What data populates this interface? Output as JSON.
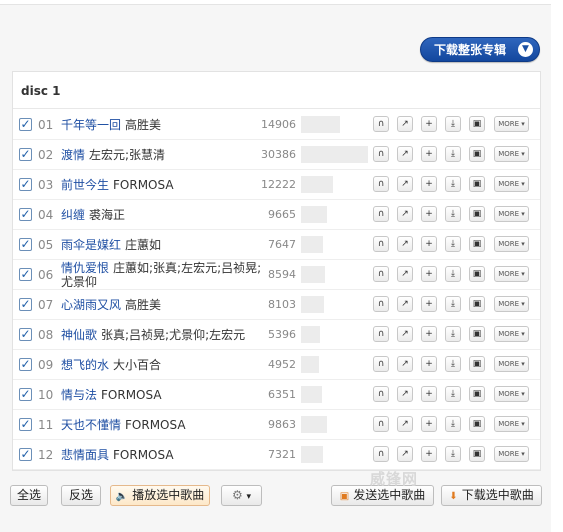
{
  "album": {
    "download_label": "下载整张专辑",
    "download_icon": "download-circle-icon"
  },
  "disc": {
    "title": "disc 1"
  },
  "tracks": [
    {
      "num": "01",
      "song": "千年等一回",
      "artist": "高胜美",
      "plays": "14906",
      "bar": 0.55
    },
    {
      "num": "02",
      "song": "渡情",
      "artist": "左宏元;张慧清",
      "plays": "30386",
      "bar": 0.95
    },
    {
      "num": "03",
      "song": "前世今生",
      "artist": "FORMOSA",
      "plays": "12222",
      "bar": 0.45
    },
    {
      "num": "04",
      "song": "纠缠",
      "artist": "裘海正",
      "plays": "9665",
      "bar": 0.37
    },
    {
      "num": "05",
      "song": "雨伞是媒红",
      "artist": "庄蕙如",
      "plays": "7647",
      "bar": 0.32
    },
    {
      "num": "06",
      "song": "情仇爱恨",
      "artist": "庄蕙如;张真;左宏元;吕祯晃;尤景仰",
      "plays": "8594",
      "bar": 0.34
    },
    {
      "num": "07",
      "song": "心湖雨又风",
      "artist": "高胜美",
      "plays": "8103",
      "bar": 0.33
    },
    {
      "num": "08",
      "song": "神仙歌",
      "artist": "张真;吕祯晃;尤景仰;左宏元",
      "plays": "5396",
      "bar": 0.27
    },
    {
      "num": "09",
      "song": "想飞的水",
      "artist": "大小百合",
      "plays": "4952",
      "bar": 0.25
    },
    {
      "num": "10",
      "song": "情与法",
      "artist": "FORMOSA",
      "plays": "6351",
      "bar": 0.3
    },
    {
      "num": "11",
      "song": "天也不懂情",
      "artist": "FORMOSA",
      "plays": "9863",
      "bar": 0.37
    },
    {
      "num": "12",
      "song": "悲情面具",
      "artist": "FORMOSA",
      "plays": "7321",
      "bar": 0.32
    }
  ],
  "row_icons": [
    "headphones-icon",
    "share-arrow-icon",
    "add-icon",
    "download-icon",
    "device-icon"
  ],
  "more_label": "MORE ▾",
  "bottom": {
    "select_all": "全选",
    "invert": "反选",
    "play_selected": "播放选中歌曲",
    "send_selected": "发送选中歌曲",
    "download_selected": "下载选中歌曲",
    "settings_arrow": "▾"
  },
  "watermark": "威锋网"
}
